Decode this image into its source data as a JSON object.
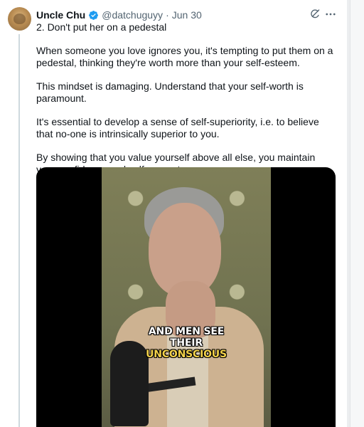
{
  "tweet": {
    "author": {
      "name": "Uncle Chu",
      "handle": "@datchuguyy",
      "separator": "·",
      "date": "Jun 30",
      "verified": true
    },
    "paragraphs": [
      "2. Don't put her on a pedestal",
      "When someone you love ignores you, it's tempting to put them on a pedestal, thinking they're worth more than your self-esteem.",
      "This mindset is damaging. Understand that your self-worth is paramount.",
      "It's essential to develop a sense of self-superiority, i.e. to believe that no-one is intrinsically superior to you.",
      "By showing that you value yourself above all else, you maintain your confidence and self-respect."
    ],
    "media": {
      "caption_line1": "AND MEN SEE",
      "caption_line2": "THEIR",
      "caption_line3": "UNCONSCIOUS"
    }
  },
  "colors": {
    "accent": "#1d9bf0",
    "text_primary": "#0f1419",
    "text_secondary": "#536471",
    "caption_highlight": "#f3d24a"
  },
  "icons": {
    "verified": "verified-badge-icon",
    "grok": "grok-icon",
    "more": "more-icon"
  }
}
